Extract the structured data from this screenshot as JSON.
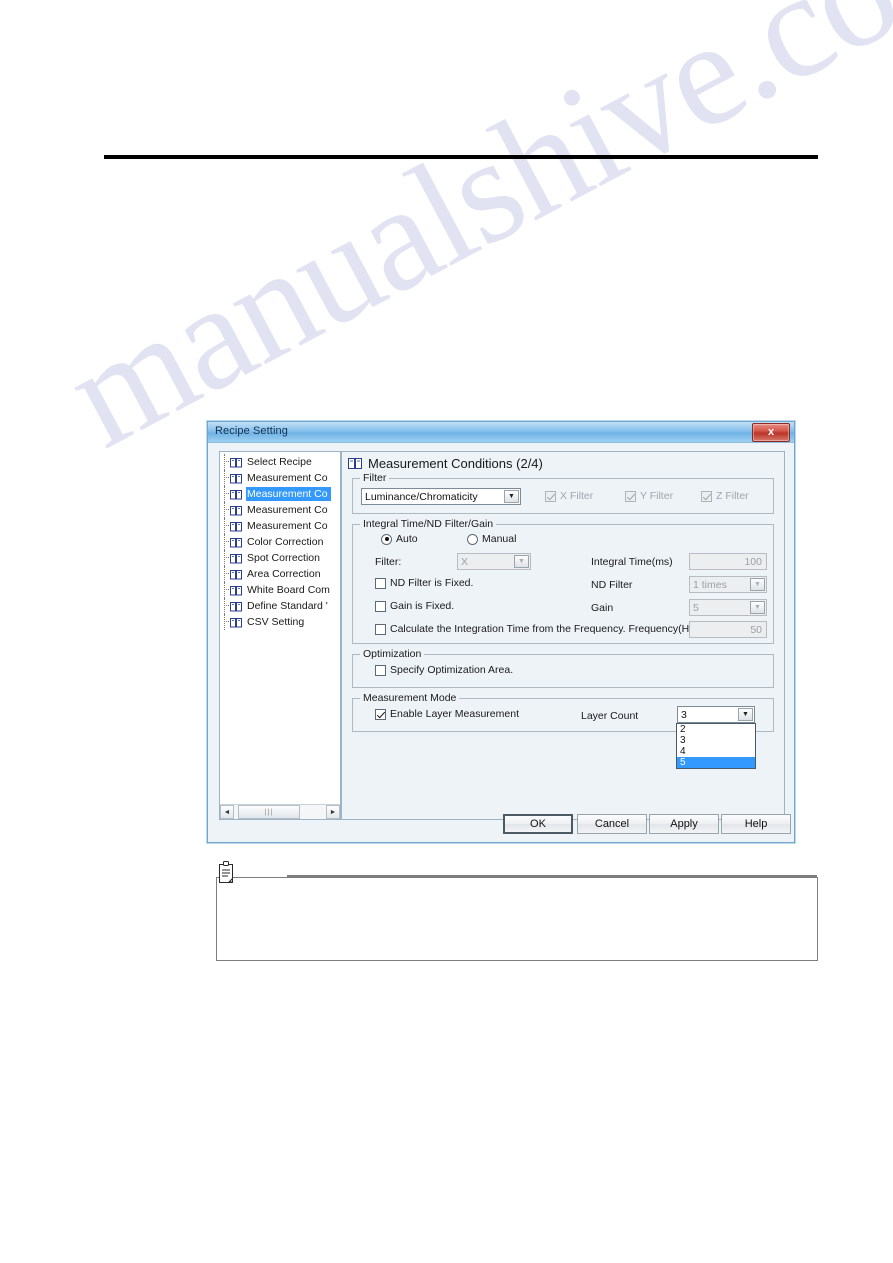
{
  "page": {
    "watermark_text": "manualshive.com"
  },
  "dialog": {
    "title": "Recipe Setting",
    "close_label": "x",
    "tree": {
      "items": [
        {
          "label": "Select Recipe",
          "selected": false
        },
        {
          "label": "Measurement Co",
          "selected": false
        },
        {
          "label": "Measurement Co",
          "selected": true
        },
        {
          "label": "Measurement Co",
          "selected": false
        },
        {
          "label": "Measurement Co",
          "selected": false
        },
        {
          "label": "Color Correction",
          "selected": false
        },
        {
          "label": "Spot Correction",
          "selected": false
        },
        {
          "label": "Area Correction",
          "selected": false
        },
        {
          "label": "White Board Com",
          "selected": false
        },
        {
          "label": "Define Standard '",
          "selected": false
        },
        {
          "label": "CSV Setting",
          "selected": false
        }
      ],
      "scroll_left_arrow": "◄",
      "scroll_right_arrow": "►",
      "scroll_thumb_grip": "|||"
    },
    "pane": {
      "header": "Measurement Conditions (2/4)",
      "filter_group": {
        "legend": "Filter",
        "combo_value": "Luminance/Chromaticity",
        "combo_arrow": "▼",
        "checkboxes": [
          {
            "label": "X Filter",
            "checked": true,
            "disabled": true
          },
          {
            "label": "Y Filter",
            "checked": true,
            "disabled": true
          },
          {
            "label": "Z Filter",
            "checked": true,
            "disabled": true
          }
        ]
      },
      "integral_group": {
        "legend": "Integral Time/ND Filter/Gain",
        "radio_auto": "Auto",
        "radio_manual": "Manual",
        "radio_selected": "Auto",
        "filter_label": "Filter:",
        "filter_value": "X",
        "filter_arrow": "▼",
        "integral_time_label": "Integral Time(ms)",
        "integral_time_value": "100",
        "nd_fixed_label": "ND Filter is Fixed.",
        "nd_fixed_checked": false,
        "nd_filter_label": "ND Filter",
        "nd_filter_value": "1 times",
        "nd_filter_arrow": "▼",
        "gain_fixed_label": "Gain is Fixed.",
        "gain_fixed_checked": false,
        "gain_label": "Gain",
        "gain_value": "5",
        "gain_arrow": "▼",
        "freq_calc_label": "Calculate the Integration Time from the Frequency. Frequency(Hz)",
        "freq_calc_checked": false,
        "freq_value": "50"
      },
      "optimization_group": {
        "legend": "Optimization",
        "specify_area_label": "Specify Optimization Area.",
        "specify_area_checked": false
      },
      "measurement_mode_group": {
        "legend": "Measurement Mode",
        "enable_layer_label": "Enable Layer Measurement",
        "enable_layer_checked": true,
        "layer_count_label": "Layer Count",
        "layer_count_value": "3",
        "layer_count_arrow": "▼",
        "layer_count_options": [
          {
            "label": "2",
            "selected": false
          },
          {
            "label": "3",
            "selected": false
          },
          {
            "label": "4",
            "selected": false
          },
          {
            "label": "5",
            "selected": true
          }
        ]
      }
    },
    "buttons": {
      "ok": "OK",
      "cancel": "Cancel",
      "apply": "Apply",
      "help": "Help"
    }
  },
  "note": {
    "icon_name": "memo-icon",
    "text": ""
  }
}
